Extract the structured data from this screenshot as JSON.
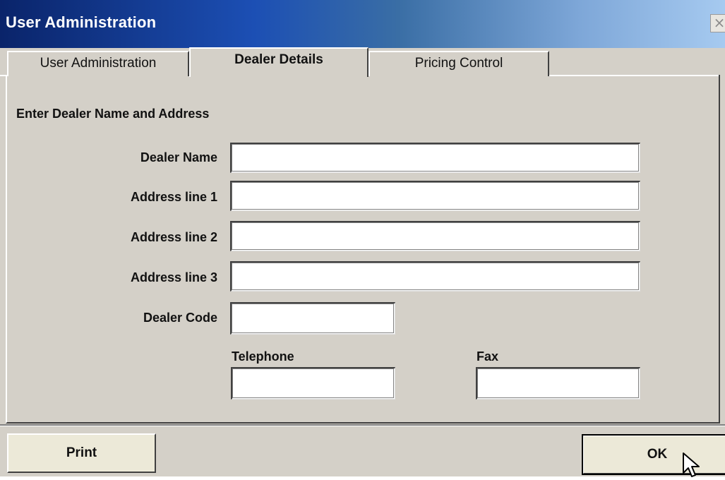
{
  "window": {
    "title": "User Administration",
    "close_glyph": "×"
  },
  "tabs": [
    {
      "label": "User Administration",
      "active": false
    },
    {
      "label": "Dealer Details",
      "active": true
    },
    {
      "label": "Pricing Control",
      "active": false
    }
  ],
  "form": {
    "heading": "Enter Dealer Name and Address",
    "dealer_name": {
      "label": "Dealer Name",
      "value": ""
    },
    "address_line_1": {
      "label": "Address line 1",
      "value": ""
    },
    "address_line_2": {
      "label": "Address line 2",
      "value": ""
    },
    "address_line_3": {
      "label": "Address line 3",
      "value": ""
    },
    "dealer_code": {
      "label": "Dealer Code",
      "value": ""
    },
    "telephone": {
      "label": "Telephone",
      "value": ""
    },
    "fax": {
      "label": "Fax",
      "value": ""
    }
  },
  "buttons": {
    "print_label": "Print",
    "ok_label": "OK"
  },
  "icons": {
    "close": "close-icon",
    "cursor": "mouse-pointer-icon"
  },
  "colors": {
    "titlebar_start": "#0a246a",
    "titlebar_end": "#a6caf0",
    "face": "#d4d0c8",
    "field": "#ffffff"
  }
}
